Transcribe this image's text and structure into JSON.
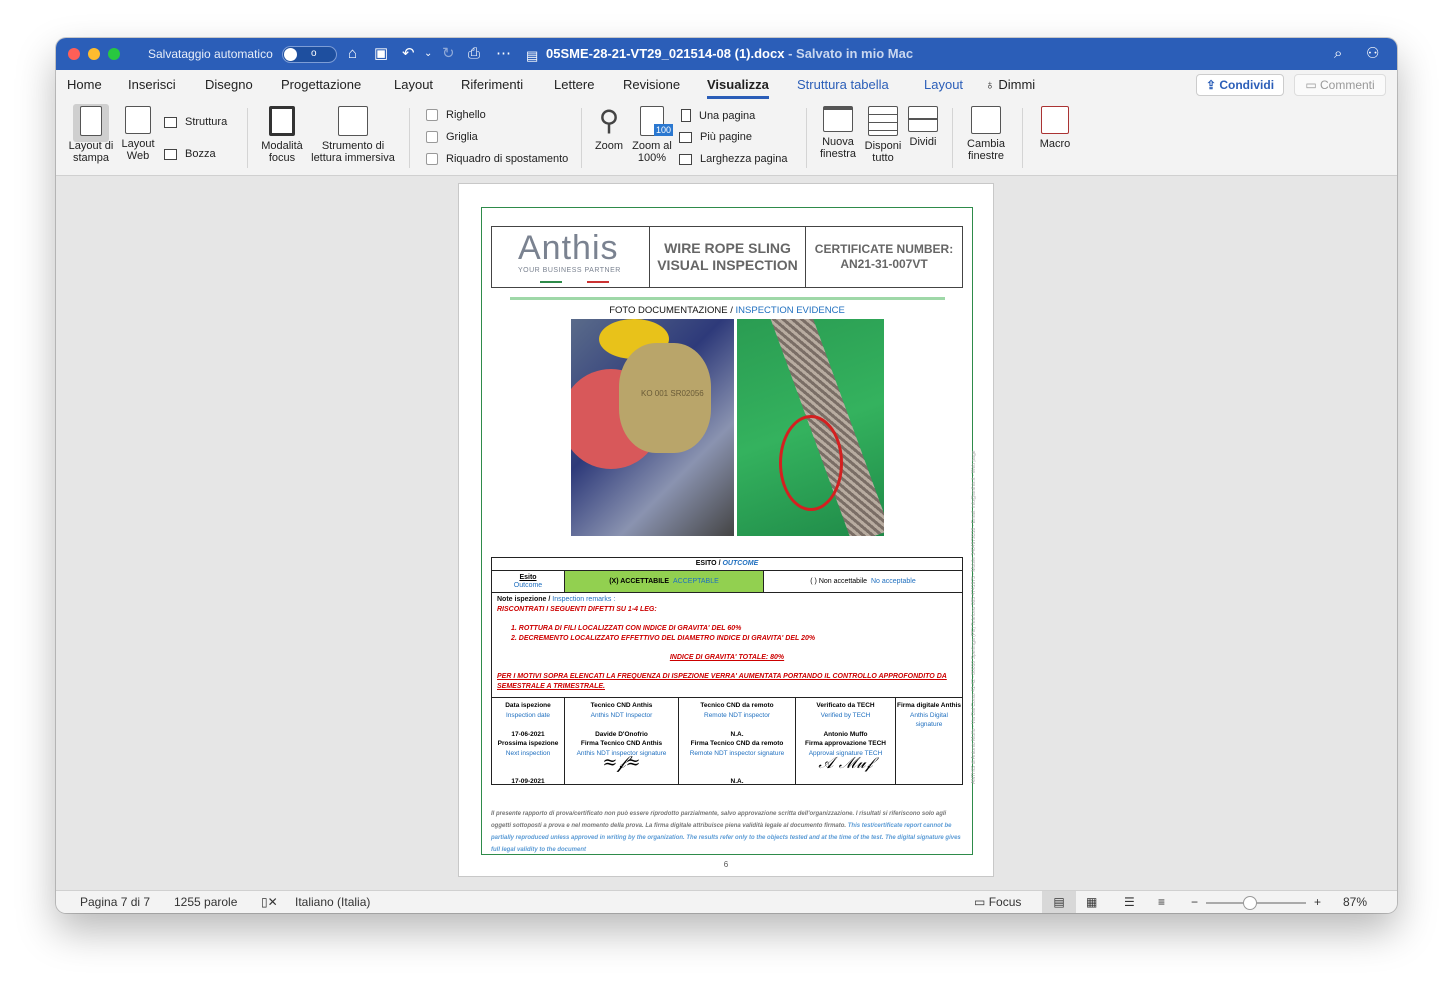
{
  "titlebar": {
    "autosave_label": "Salvataggio automatico",
    "autosave_state": "o",
    "doc_name": "05SME-28-21-VT29_021514-08 (1).docx",
    "save_status": " - Salvato in mio Mac"
  },
  "menu": {
    "tabs": [
      "Home",
      "Inserisci",
      "Disegno",
      "Progettazione",
      "Layout",
      "Riferimenti",
      "Lettere",
      "Revisione",
      "Visualizza",
      "Struttura tabella",
      "Layout",
      "Dimmi"
    ],
    "share": "Condividi",
    "comments": "Commenti"
  },
  "ribbon": {
    "layout_stampa": "Layout di stampa",
    "layout_web": "Layout Web",
    "struttura": "Struttura",
    "bozza": "Bozza",
    "modalita_focus": "Modalità focus",
    "strumento": "Strumento di lettura immersiva",
    "righello": "Righello",
    "griglia": "Griglia",
    "riquadro": "Riquadro di spostamento",
    "zoom": "Zoom",
    "zoom100": "Zoom al 100%",
    "zoom100_badge": "100",
    "una_pagina": "Una pagina",
    "piu_pagine": "Più pagine",
    "larghezza": "Larghezza pagina",
    "nuova_finestra": "Nuova finestra",
    "disponi": "Disponi tutto",
    "dividi": "Dividi",
    "cambia": "Cambia finestre",
    "macro": "Macro"
  },
  "doc": {
    "logo": "Anthis",
    "logo_tag": "YOUR BUSINESS PARTNER",
    "title1": "WIRE ROPE SLING",
    "title2": "VISUAL INSPECTION",
    "cert_label": "CERTIFICATE NUMBER:",
    "cert_no": "AN21-31-007VT",
    "foto_it": "FOTO DOCUMENTAZIONE / ",
    "foto_en": "INSPECTION EVIDENCE",
    "photo_text": "KO 001 SR02056",
    "esito_head_it": "ESITO / ",
    "esito_head_en": "OUTCOME",
    "esito_label": "Esito",
    "esito_label_en": "Outcome",
    "acc": "(X) ACCETTABILE",
    "acc_en": "ACCEPTABLE",
    "nonacc": "( ) Non accettabile",
    "nonacc_en": "No acceptable",
    "notes_head": "Note ispezione /",
    "notes_head_en": "Inspection remarks :",
    "n1": "RISCONTRATI I SEGUENTI DIFETTI SU 1-4 LEG:",
    "n2": "1.    ROTTURA DI FILI LOCALIZZATI CON INDICE DI GRAVITA' DEL 60%",
    "n3": "2.    DECREMENTO LOCALIZZATO EFFETTIVO DEL DIAMETRO INDICE DI GRAVITA' DEL 20%",
    "n4": "INDICE DI GRAVITA' TOTALE: 80%",
    "n5": "PER I MOTIVI SOPRA ELENCATI LA FREQUENZA DI ISPEZIONE VERRA' AUMENTATA PORTANDO IL CONTROLLO APPROFONDITO DA SEMESTRALE A TRIMESTRALE.",
    "c1a": "Data ispezione",
    "c1b": "Inspection date",
    "c1c": "17-06-2021",
    "c1d": "Prossima ispezione",
    "c1e": "Next inspection",
    "c1f": "17-09-2021",
    "c2a": "Tecnico CND Anthis",
    "c2b": "Anthis NDT Inspector",
    "c2c": "Davide D'Onofrio",
    "c2d": "Firma Tecnico CND Anthis",
    "c2e": "Anthis NDT inspector signature",
    "c3a": "Tecnico CND da remoto",
    "c3b": "Remote NDT inspector",
    "c3c": "N.A.",
    "c3d": "Firma Tecnico CND da remoto",
    "c3e": "Remote NDT inspector signature",
    "c3f": "N.A.",
    "c4a": "Verificato da TECH",
    "c4b": "Verified by TECH",
    "c4c": "Antonio Muffo",
    "c4d": "Firma approvazione TECH",
    "c4e": "Approval signature TECH",
    "c5a": "Firma digitale Anthis",
    "c5b": "Anthis Digital signature",
    "disc_it": "Il presente rapporto di prova/certificato non può essere riprodotto parzialmente, salvo approvazione scritta dell'organizzazione. I risultati si riferiscono solo agli oggetti sottoposti a prova e nel momento della prova. La firma digitale attribuisce piena validità legale al documento firmato.",
    "disc_en": "This test/certificate report cannot be partially reproduced unless approved in writing by the organization. The results refer only to the objects tested and at the time of the test. The digital signature gives full legal validity to the document",
    "page_num": "6",
    "side_text": "ANTHIS di Antonio Muffo - Via Dal Corso 41-42 - 80010 Sperlinga (PE) Telefono 085 4741975 - Mobile 3404979318 - Email: info@anthis.it - Web page"
  },
  "status": {
    "page": "Pagina 7 di 7",
    "words": "1255 parole",
    "lang": "Italiano (Italia)",
    "focus": "Focus",
    "zoom": "87%"
  }
}
